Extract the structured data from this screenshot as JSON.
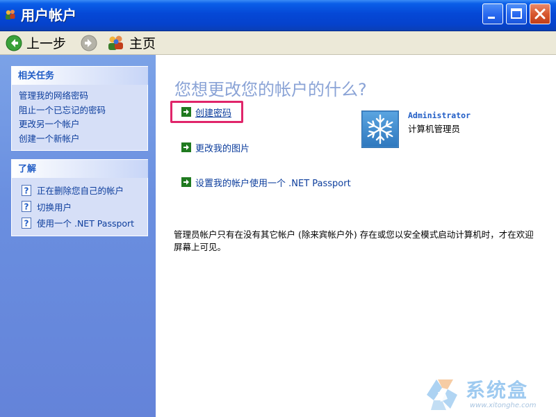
{
  "window": {
    "title": "用户帐户",
    "title_icon": "user-accounts-icon"
  },
  "toolbar": {
    "back_label": "上一步",
    "home_label": "主页",
    "back_icon": "back-arrow-icon",
    "forward_icon": "forward-arrow-icon",
    "home_icon": "users-home-icon"
  },
  "sidebar": {
    "related_tasks": {
      "title": "相关任务",
      "items": [
        "管理我的网络密码",
        "阻止一个已忘记的密码",
        "更改另一个帐户",
        "创建一个新帐户"
      ]
    },
    "learn_about": {
      "title": "了解",
      "items": [
        "正在删除您自己的帐户",
        "切换用户",
        "使用一个 .NET Passport"
      ],
      "item_icon": "help-icon"
    }
  },
  "main": {
    "question": "您想更改您的帐户的什么?",
    "actions": [
      {
        "label": "创建密码",
        "icon": "green-arrow-icon",
        "highlighted": true
      },
      {
        "label": "更改我的图片",
        "icon": "green-arrow-icon"
      },
      {
        "label": "设置我的帐户使用一个 .NET Passport",
        "icon": "green-arrow-icon"
      }
    ],
    "user": {
      "name": "Administrator",
      "role": "计算机管理员",
      "avatar_icon": "snowflake-avatar-icon"
    },
    "info": "管理员帐户只有在没有其它帐户 (除来宾帐户外) 存在或您以安全模式启动计算机时，才在欢迎屏幕上可见。"
  },
  "watermark": {
    "brand": "系统盒",
    "url": "www.xitonghe.com"
  },
  "colors": {
    "title_bar": "#0548d6",
    "sidebar": "#6a8fe0",
    "link": "#0c3d9c",
    "highlight_box": "#e0256a",
    "question": "#8aa3d6"
  }
}
